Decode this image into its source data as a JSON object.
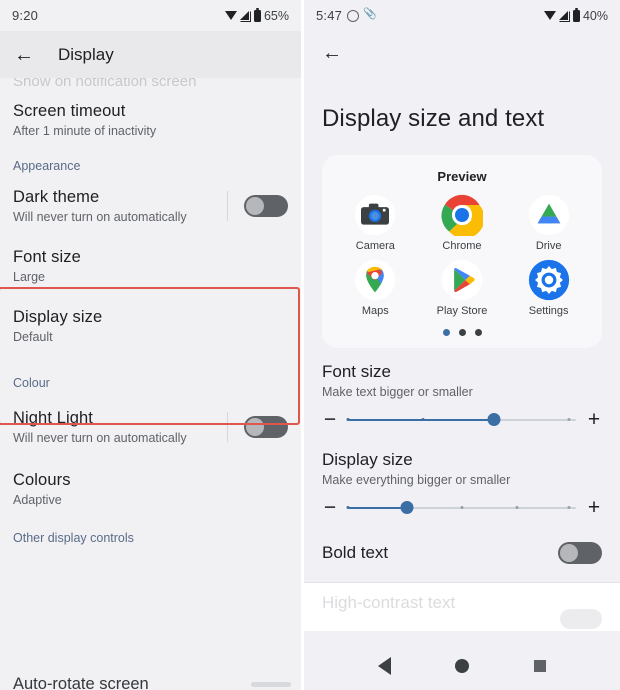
{
  "left_screen": {
    "status_bar": {
      "time": "9:20",
      "battery": "65%",
      "icons": [
        "wifi-icon",
        "signal-icon",
        "battery-icon"
      ]
    },
    "appbar": {
      "back_icon": "back-arrow-icon",
      "title": "Display"
    },
    "cut_top_row": "Show on notification screen",
    "rows": [
      {
        "title": "Screen timeout",
        "subtitle": "After 1 minute of inactivity",
        "toggle": false
      },
      {
        "title": "Dark theme",
        "subtitle": "Will never turn on automatically",
        "toggle": true,
        "toggle_state": "off"
      },
      {
        "title": "Font size",
        "subtitle": "Large",
        "toggle": false
      },
      {
        "title": "Display size",
        "subtitle": "Default",
        "toggle": false
      },
      {
        "title": "Night Light",
        "subtitle": "Will never turn on automatically",
        "toggle": true,
        "toggle_state": "off"
      },
      {
        "title": "Colours",
        "subtitle": "Adaptive",
        "toggle": false
      }
    ],
    "section_appearance": "Appearance",
    "section_colour": "Colour",
    "section_other": "Other display controls",
    "cut_bottom_row": "Auto-rotate screen",
    "highlight_color": "#e0564f"
  },
  "right_screen": {
    "status_bar": {
      "time": "5:47",
      "battery": "40%",
      "icons": [
        "chat-icon",
        "pin-icon",
        "wifi-icon",
        "signal-icon",
        "battery-icon"
      ]
    },
    "appbar": {
      "back_icon": "back-arrow-icon"
    },
    "title": "Display size and text",
    "preview": {
      "label": "Preview",
      "apps": [
        {
          "name": "Camera",
          "icon": "camera-icon"
        },
        {
          "name": "Chrome",
          "icon": "chrome-icon"
        },
        {
          "name": "Drive",
          "icon": "drive-icon"
        },
        {
          "name": "Maps",
          "icon": "maps-icon"
        },
        {
          "name": "Play Store",
          "icon": "play-store-icon"
        },
        {
          "name": "Settings",
          "icon": "settings-icon"
        }
      ],
      "page_dots": {
        "count": 3,
        "active_index": 0,
        "active_color": "#3b6ea5"
      }
    },
    "font_size": {
      "title": "Font size",
      "subtitle": "Make text bigger or smaller",
      "minus": "−",
      "plus": "+",
      "steps": 4,
      "value_index": 2,
      "fill_percent": 64,
      "tick_positions": [
        0,
        33,
        64,
        97
      ]
    },
    "display_size": {
      "title": "Display size",
      "subtitle": "Make everything bigger or smaller",
      "minus": "−",
      "plus": "+",
      "steps": 5,
      "value_index": 1,
      "fill_percent": 26,
      "tick_positions": [
        0,
        26,
        50,
        74,
        97
      ]
    },
    "bold_text": {
      "title": "Bold text",
      "toggle_state": "off"
    },
    "high_contrast": {
      "title": "High-contrast text",
      "subtitle": ""
    },
    "navbar": {
      "back": "nav-back-icon",
      "home": "nav-home-icon",
      "recents": "nav-recents-icon"
    },
    "accent_color": "#3b6ea5"
  }
}
